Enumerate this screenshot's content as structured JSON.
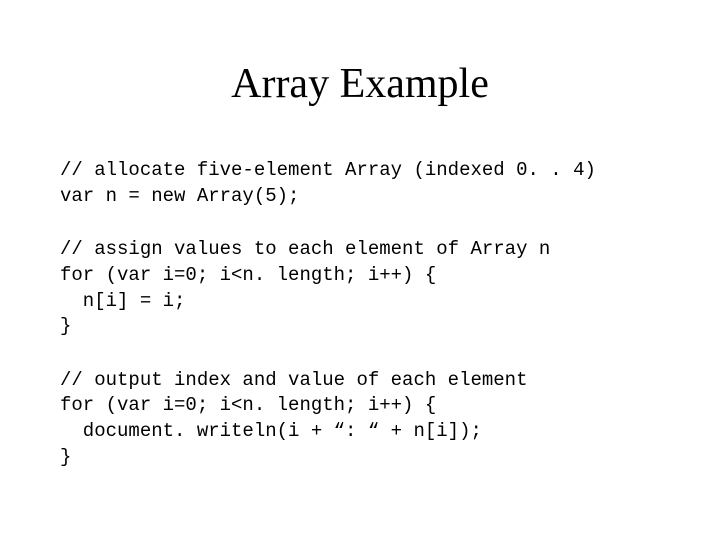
{
  "title": "Array Example",
  "code": {
    "block1": "// allocate five-element Array (indexed 0. . 4)\nvar n = new Array(5);",
    "block2": "// assign values to each element of Array n\nfor (var i=0; i<n. length; i++) {\n  n[i] = i;\n}",
    "block3": "// output index and value of each element\nfor (var i=0; i<n. length; i++) {\n  document. writeln(i + “: “ + n[i]);\n}"
  }
}
